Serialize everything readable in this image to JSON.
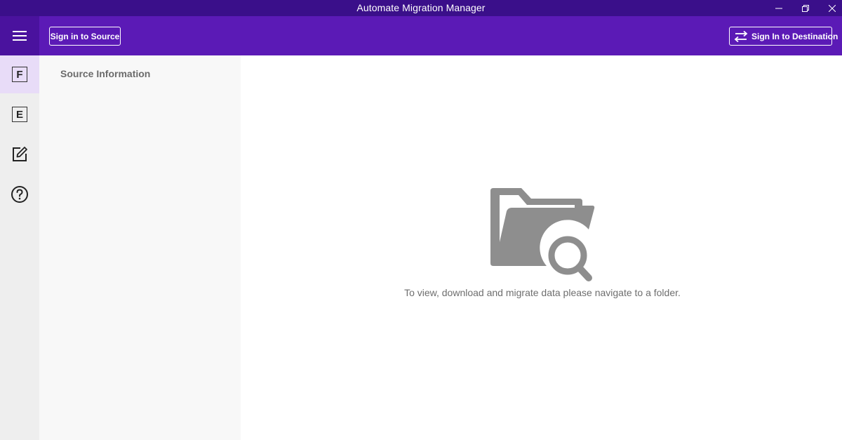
{
  "window": {
    "title": "Automate Migration Manager",
    "controls": {
      "minimize_icon": "minimize-icon",
      "restore_icon": "restore-icon",
      "close_icon": "close-icon"
    }
  },
  "header": {
    "menu_icon": "hamburger-menu-icon",
    "sign_in_source_label": "Sign in to Source",
    "sign_in_destination_label": "Sign In to Destination",
    "destination_icon": "swap-arrows-icon"
  },
  "sidebar": {
    "items": [
      {
        "id": "files",
        "glyph": "F",
        "icon": "files-letter-icon",
        "active": true
      },
      {
        "id": "exchange",
        "glyph": "E",
        "icon": "exchange-letter-icon",
        "active": false
      },
      {
        "id": "edit",
        "icon": "edit-icon",
        "active": false
      },
      {
        "id": "help",
        "icon": "help-icon",
        "active": false
      }
    ]
  },
  "source_panel": {
    "title": "Source Information"
  },
  "main": {
    "empty_state_icon": "folder-search-icon",
    "empty_state_message": "To view, download and migrate data please navigate to a folder."
  },
  "colors": {
    "titlebar": "#3a0f8a",
    "header": "#5b1ab6",
    "menu_area": "#4a129e",
    "active_rail": "#e8dcf8",
    "icon_gray": "#8e8e8e"
  }
}
